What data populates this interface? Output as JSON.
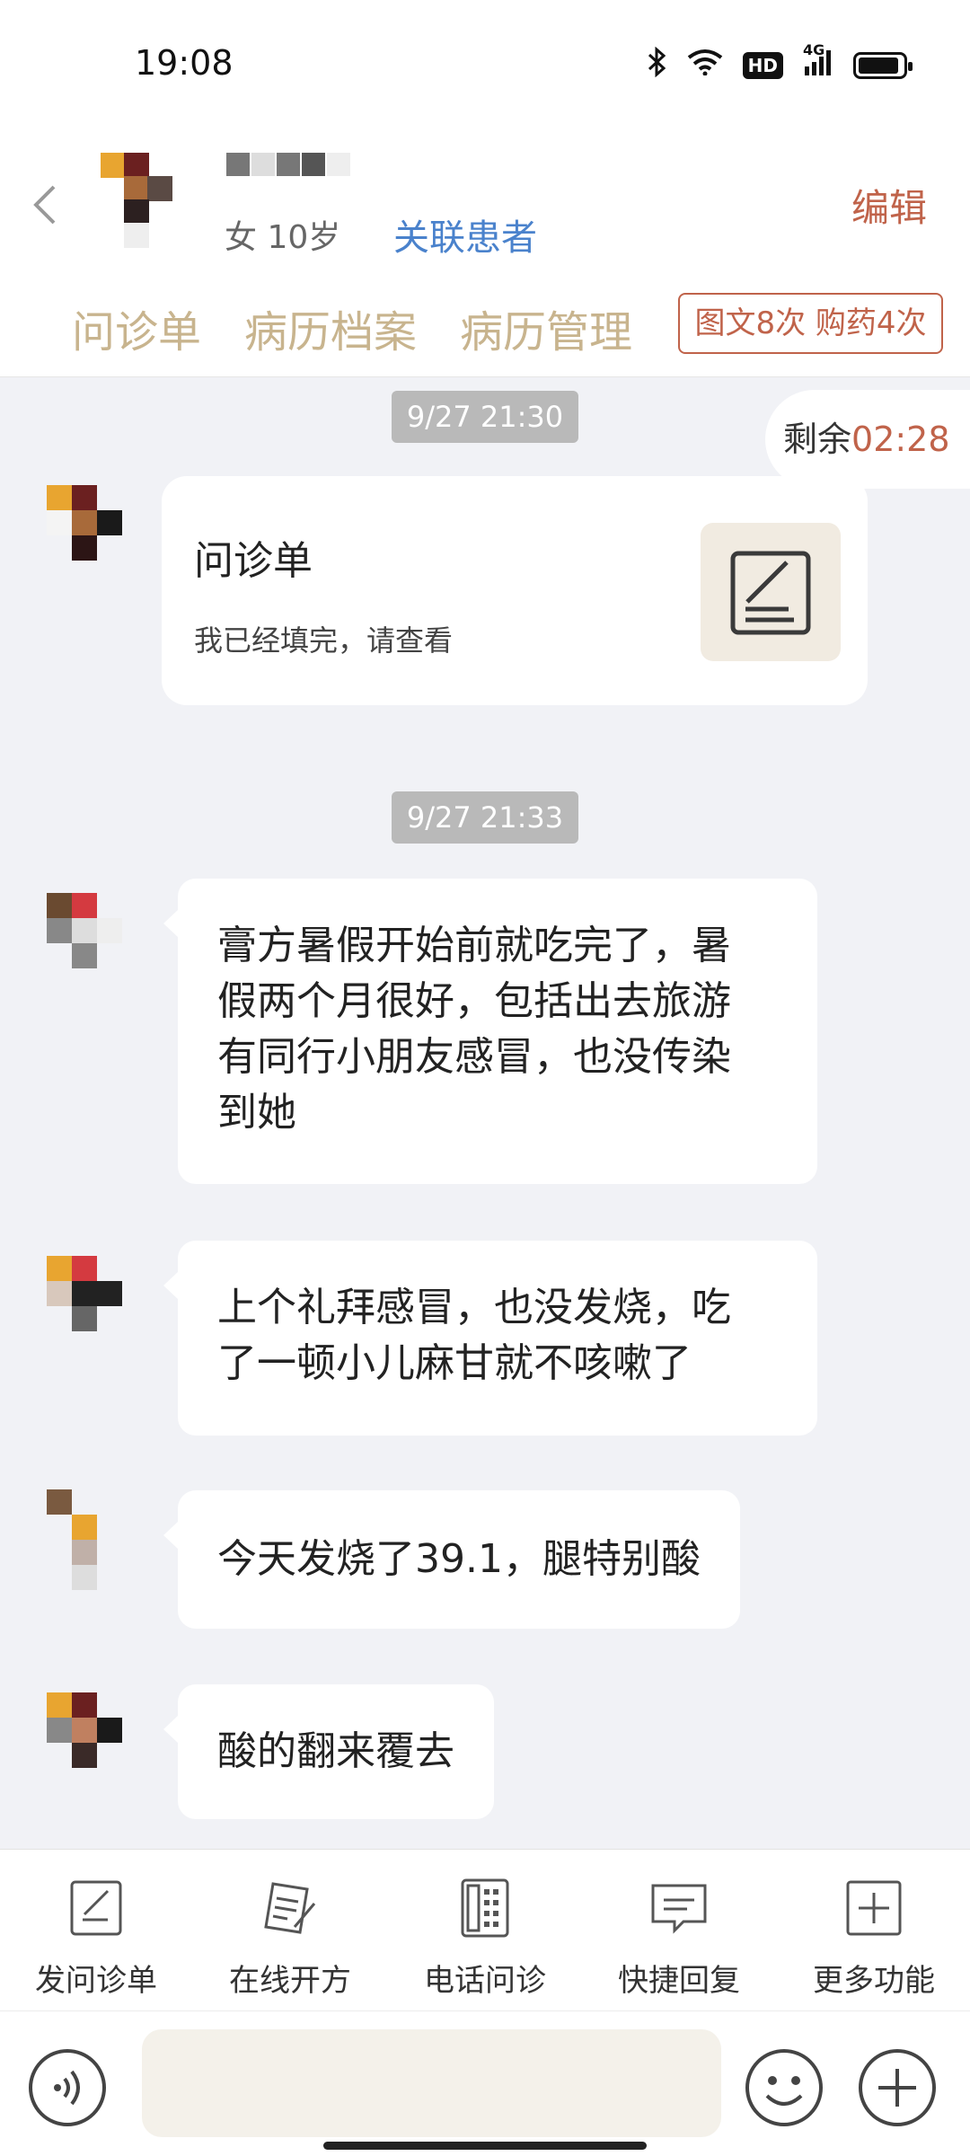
{
  "status_bar": {
    "time": "19:08",
    "hd_label": "HD",
    "network_label": "4G"
  },
  "header": {
    "patient_info": "女 10岁",
    "link_patient_label": "关联患者",
    "edit_label": "编辑",
    "tabs": [
      {
        "label": "问诊单"
      },
      {
        "label": "病历档案"
      },
      {
        "label": "病历管理"
      }
    ],
    "quota_label": "图文8次 购药4次"
  },
  "chat": {
    "remaining_label": "剩余",
    "remaining_time": "02:28",
    "timestamps": [
      "9/27 21:30",
      "9/27 21:33"
    ],
    "form_card": {
      "title": "问诊单",
      "subtitle": "我已经填完，请查看",
      "icon": "form-edit-icon"
    },
    "messages": [
      {
        "lines": [
          "膏方暑假开始前就吃完了，暑",
          "假两个月很好，包括出去旅游",
          "有同行小朋友感冒，也没传染",
          "到她"
        ]
      },
      {
        "lines": [
          "上个礼拜感冒，也没发烧，吃",
          "了一顿小儿麻甘就不咳嗽了"
        ]
      },
      {
        "lines": [
          "今天发烧了39.1，腿特别酸"
        ]
      },
      {
        "lines": [
          "酸的翻来覆去"
        ]
      }
    ]
  },
  "toolbar": {
    "items": [
      {
        "label": "发问诊单",
        "icon": "form-send-icon"
      },
      {
        "label": "在线开方",
        "icon": "prescription-icon"
      },
      {
        "label": "电话问诊",
        "icon": "phone-keypad-icon"
      },
      {
        "label": "快捷回复",
        "icon": "quick-reply-icon"
      },
      {
        "label": "更多功能",
        "icon": "more-plus-icon"
      }
    ]
  },
  "input_bar": {
    "placeholder": "",
    "value": ""
  },
  "colors": {
    "accent": "#c0634a",
    "tab_text": "#c8b48e",
    "link_blue": "#4a82cc",
    "chat_bg": "#f1f2f6",
    "timestamp_bg": "#b9b9b9",
    "input_bg": "#f4f1ea"
  }
}
